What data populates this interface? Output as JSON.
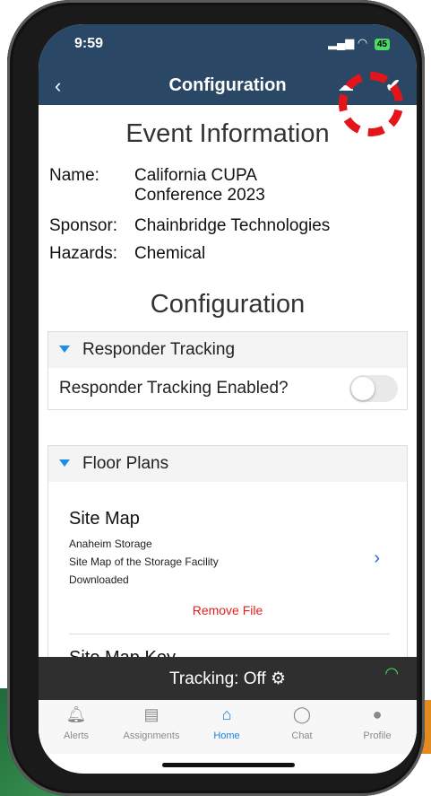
{
  "status": {
    "time": "9:59",
    "battery": "45"
  },
  "nav": {
    "back_icon": "chevron-left-icon",
    "title": "Configuration",
    "confirm_icon": "checkmark-icon"
  },
  "event": {
    "heading": "Event Information",
    "name_label": "Name:",
    "name_line1": "California CUPA",
    "name_line2": "Conference 2023",
    "sponsor_label": "Sponsor:",
    "sponsor_value": "Chainbridge Technologies",
    "hazards_label": "Hazards:",
    "hazards_value": "Chemical"
  },
  "config": {
    "heading": "Configuration",
    "responder": {
      "label": "Responder Tracking",
      "toggle_label": "Responder Tracking Enabled?",
      "enabled": false
    },
    "floor_plans": {
      "label": "Floor Plans",
      "files": [
        {
          "title": "Site Map",
          "location": "Anaheim Storage",
          "description": "Site Map of the Storage Facility",
          "status": "Downloaded",
          "action": "Remove File"
        },
        {
          "title": "Site Map Key"
        }
      ]
    }
  },
  "tracking": {
    "text": "Tracking:  Off"
  },
  "tabs": [
    {
      "label": "Alerts",
      "icon": "bell-icon"
    },
    {
      "label": "Assignments",
      "icon": "documents-icon"
    },
    {
      "label": "Home",
      "icon": "home-icon",
      "active": true
    },
    {
      "label": "Chat",
      "icon": "chat-bubble-icon"
    },
    {
      "label": "Profile",
      "icon": "person-icon"
    }
  ],
  "colors": {
    "header": "#2a4766",
    "accent": "#1e8fe8",
    "danger": "#e02020",
    "highlight": "#e4151a"
  }
}
